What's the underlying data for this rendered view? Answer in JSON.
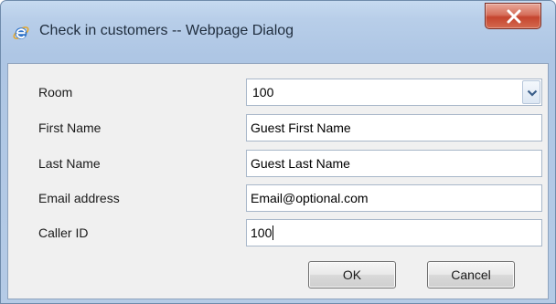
{
  "window": {
    "title": "Check in customers -- Webpage Dialog",
    "icon": "internet-explorer-icon",
    "close_icon": "close-icon"
  },
  "form": {
    "room": {
      "label": "Room",
      "value": "100",
      "icon": "chevron-down-icon"
    },
    "first_name": {
      "label": "First Name",
      "value": "Guest First Name"
    },
    "last_name": {
      "label": "Last Name",
      "value": "Guest Last Name"
    },
    "email": {
      "label": "Email address",
      "value": "Email@optional.com"
    },
    "caller_id": {
      "label": "Caller ID",
      "value": "100"
    }
  },
  "buttons": {
    "ok": "OK",
    "cancel": "Cancel"
  },
  "colors": {
    "frame": "#aec6e4",
    "client_bg": "#f0f0f0",
    "close_button": "#c5452f",
    "field_border": "#a8b7c9"
  }
}
